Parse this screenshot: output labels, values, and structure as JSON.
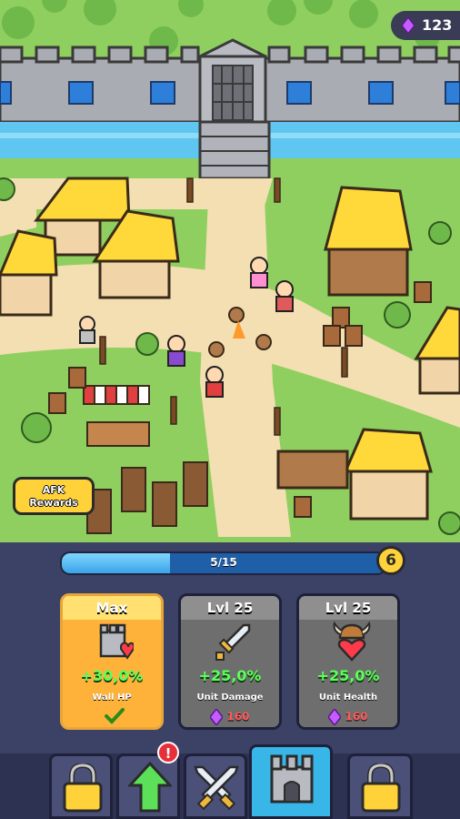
{
  "currency": {
    "gems": "123"
  },
  "progress": {
    "text": "5/15",
    "fraction": 0.333,
    "level": "6"
  },
  "afk_button": {
    "line1": "AFK",
    "line2": "Rewards"
  },
  "cards": [
    {
      "header": "Max",
      "value": "+30,0%",
      "name": "Wall HP",
      "state": "maxed",
      "icon": "wall-heart-icon"
    },
    {
      "header": "Lvl 25",
      "value": "+25,0%",
      "name": "Unit Damage",
      "cost": "160",
      "icon": "sword-icon"
    },
    {
      "header": "Lvl 25",
      "value": "+25,0%",
      "name": "Unit Health",
      "cost": "160",
      "icon": "viking-heart-icon"
    }
  ],
  "tabs": [
    {
      "icon": "lock-icon",
      "state": "locked"
    },
    {
      "icon": "upgrade-arrow-icon",
      "state": "notification",
      "badge": "!"
    },
    {
      "icon": "crossed-swords-icon",
      "state": "normal"
    },
    {
      "icon": "castle-icon",
      "state": "active"
    },
    {
      "icon": "lock-icon",
      "state": "locked"
    }
  ],
  "colors": {
    "accent": "#39b6e8",
    "gold": "#ffd23a",
    "value_green": "#5cff5a",
    "cost_red": "#ff5a5a"
  }
}
